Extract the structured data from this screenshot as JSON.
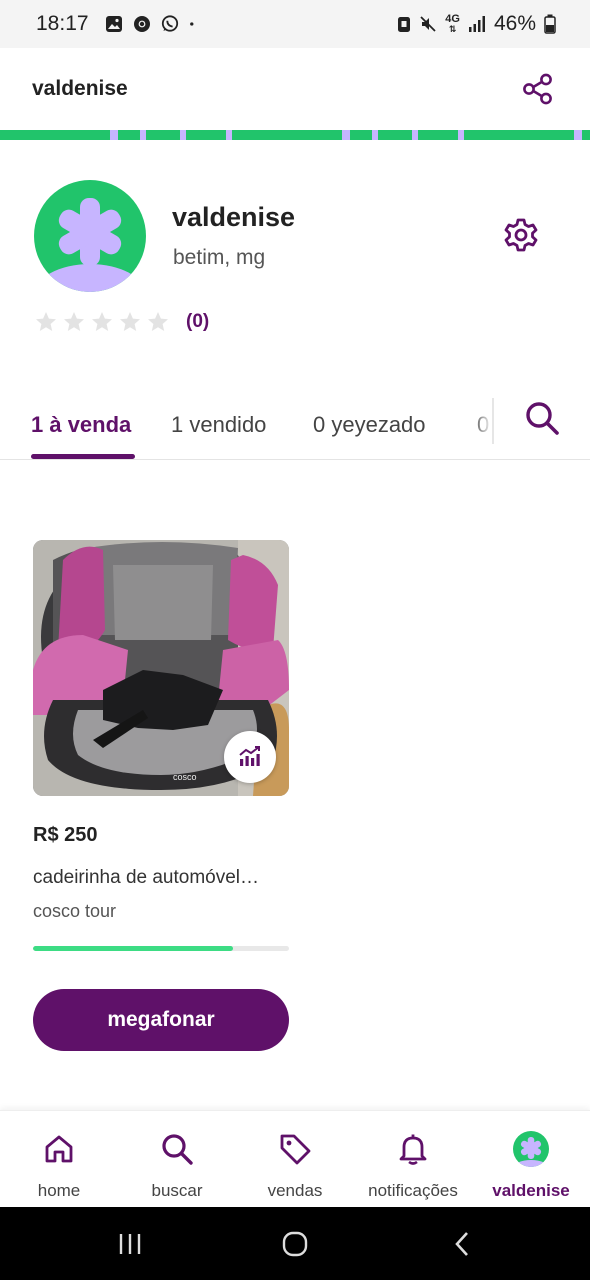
{
  "status_bar": {
    "time": "18:17",
    "battery": "46%",
    "network": "4G",
    "notification_icons": [
      "gallery-icon",
      "chrome-icon",
      "whatsapp-icon",
      "dot-icon"
    ]
  },
  "app_bar": {
    "title": "valdenise",
    "share_icon": "share-icon"
  },
  "colors": {
    "brand_purple": "#5f1169",
    "brand_green": "#21c46b",
    "lilac": "#c7b5ff",
    "progress_green": "#3ddc84"
  },
  "profile": {
    "name": "valdenise",
    "location": "betim, mg",
    "rating_count": "(0)",
    "stars": 0
  },
  "tabs": [
    {
      "label": "1 à venda",
      "active": true
    },
    {
      "label": "1 vendido",
      "active": false
    },
    {
      "label": "0 yeyezado",
      "active": false
    },
    {
      "label": "0",
      "active": false
    }
  ],
  "product": {
    "price": "R$ 250",
    "title": "cadeirinha de automóvel…",
    "brand": "cosco tour",
    "image_brand_text": "cosco",
    "progress": 0.78,
    "megafone_label": "megafonar"
  },
  "bottom_nav": [
    {
      "label": "home",
      "icon": "home-icon"
    },
    {
      "label": "buscar",
      "icon": "search-icon"
    },
    {
      "label": "vendas",
      "icon": "tag-icon"
    },
    {
      "label": "notificações",
      "icon": "bell-icon"
    },
    {
      "label": "valdenise",
      "icon": "avatar",
      "active": true
    }
  ]
}
